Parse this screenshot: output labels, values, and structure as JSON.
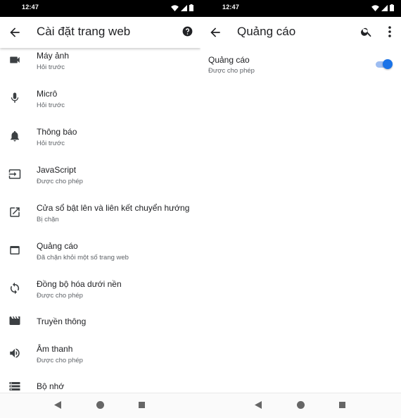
{
  "left": {
    "status_time": "12:47",
    "title": "Cài đặt trang web",
    "items": [
      {
        "label": "Máy ảnh",
        "sub": "Hỏi trước",
        "icon": "videocam-icon"
      },
      {
        "label": "Micrô",
        "sub": "Hỏi trước",
        "icon": "mic-icon"
      },
      {
        "label": "Thông báo",
        "sub": "Hỏi trước",
        "icon": "bell-icon"
      },
      {
        "label": "JavaScript",
        "sub": "Được cho phép",
        "icon": "input-icon"
      },
      {
        "label": "Cửa sổ bật lên và liên kết chuyển hướng",
        "sub": "Bị chặn",
        "icon": "open-in-new-icon"
      },
      {
        "label": "Quảng cáo",
        "sub": "Đã chặn khỏi một số trang web",
        "icon": "web-asset-icon"
      },
      {
        "label": "Đồng bộ hóa dưới nền",
        "sub": "Được cho phép",
        "icon": "sync-icon"
      },
      {
        "label": "Truyền thông",
        "sub": "",
        "icon": "movie-icon"
      },
      {
        "label": "Âm thanh",
        "sub": "Được cho phép",
        "icon": "volume-icon"
      },
      {
        "label": "Bộ nhớ",
        "sub": "",
        "icon": "storage-icon"
      }
    ]
  },
  "right": {
    "status_time": "12:47",
    "title": "Quảng cáo",
    "setting": {
      "label": "Quảng cáo",
      "sub": "Được cho phép",
      "enabled": true
    }
  },
  "colors": {
    "accent": "#1a73e8",
    "accent_track": "#9dbdf2",
    "status_bar": "#000000",
    "secondary_text": "#5f6368"
  }
}
